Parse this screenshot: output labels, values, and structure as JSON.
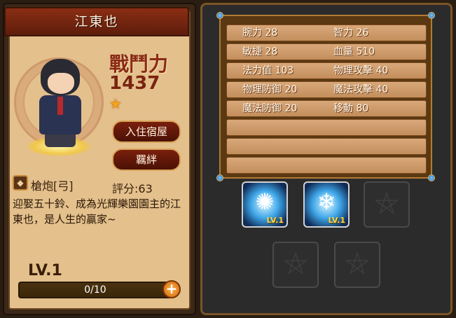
{
  "character": {
    "name": "江東也",
    "power_label": "戰鬥力",
    "power_value": "1437",
    "rarity_icon": "star-icon"
  },
  "buttons": {
    "lodge": "入住宿屋",
    "bond": "羈絆"
  },
  "weapon": {
    "icon": "weapon-icon",
    "label": "槍炮[弓]"
  },
  "score": "評分:63",
  "description": "迎娶五十鈴、成為光輝樂園園主的江東也，是人生的贏家~",
  "level": {
    "label": "LV.1",
    "xp_text": "0/10",
    "xp_fraction": 0,
    "plus_label": "+"
  },
  "stats": [
    {
      "left": "腕力 28",
      "right": "智力 26"
    },
    {
      "left": "敏捷 28",
      "right": "血量 510"
    },
    {
      "left": "法力值 103",
      "right": "物理攻擊 40"
    },
    {
      "left": "物理防御 20",
      "right": "魔法攻擊 40"
    },
    {
      "left": "魔法防御 20",
      "right": "移動 80"
    },
    {
      "left": "",
      "right": ""
    },
    {
      "left": "",
      "right": ""
    },
    {
      "left": "",
      "right": ""
    }
  ],
  "skills": [
    {
      "icon": "sun-burst-icon",
      "level": "LV.1",
      "locked": false
    },
    {
      "icon": "ice-shard-icon",
      "level": "LV.1",
      "locked": false
    },
    {
      "icon": "pentagram-icon",
      "level": "",
      "locked": true
    },
    {
      "icon": "pentagram-icon",
      "level": "",
      "locked": true
    },
    {
      "icon": "pentagram-icon",
      "level": "",
      "locked": true
    }
  ],
  "colors": {
    "accent": "#8a2e14",
    "panel": "#e3c08c",
    "stat_row": "#d9a87a",
    "skill_active": "#3ea6e8"
  }
}
